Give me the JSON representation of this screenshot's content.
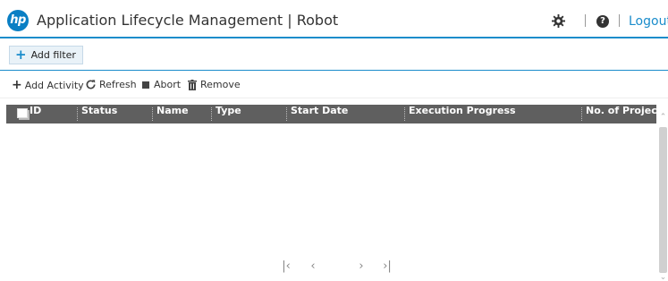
{
  "header": {
    "logo_text": "hp",
    "title": "Application Lifecycle Management | Robot",
    "help_icon_text": "?",
    "logout_label": "Logout"
  },
  "filter": {
    "add_filter_label": "Add filter"
  },
  "toolbar": {
    "add_activity_label": "Add Activity",
    "refresh_label": "Refresh",
    "abort_label": "Abort",
    "remove_label": "Remove"
  },
  "grid": {
    "columns": [
      "ID",
      "Status",
      "Name",
      "Type",
      "Start Date",
      "Execution Progress",
      "No. of Projects"
    ],
    "rows": []
  },
  "pager": {
    "first_icon": "first-page-icon",
    "prev_icon": "previous-page-icon",
    "next_icon": "next-page-icon",
    "last_icon": "last-page-icon"
  },
  "colors": {
    "accent": "#1a8ccb",
    "grid_header_bg": "#5f5f5f",
    "logo_bg": "#0a7fc4"
  }
}
